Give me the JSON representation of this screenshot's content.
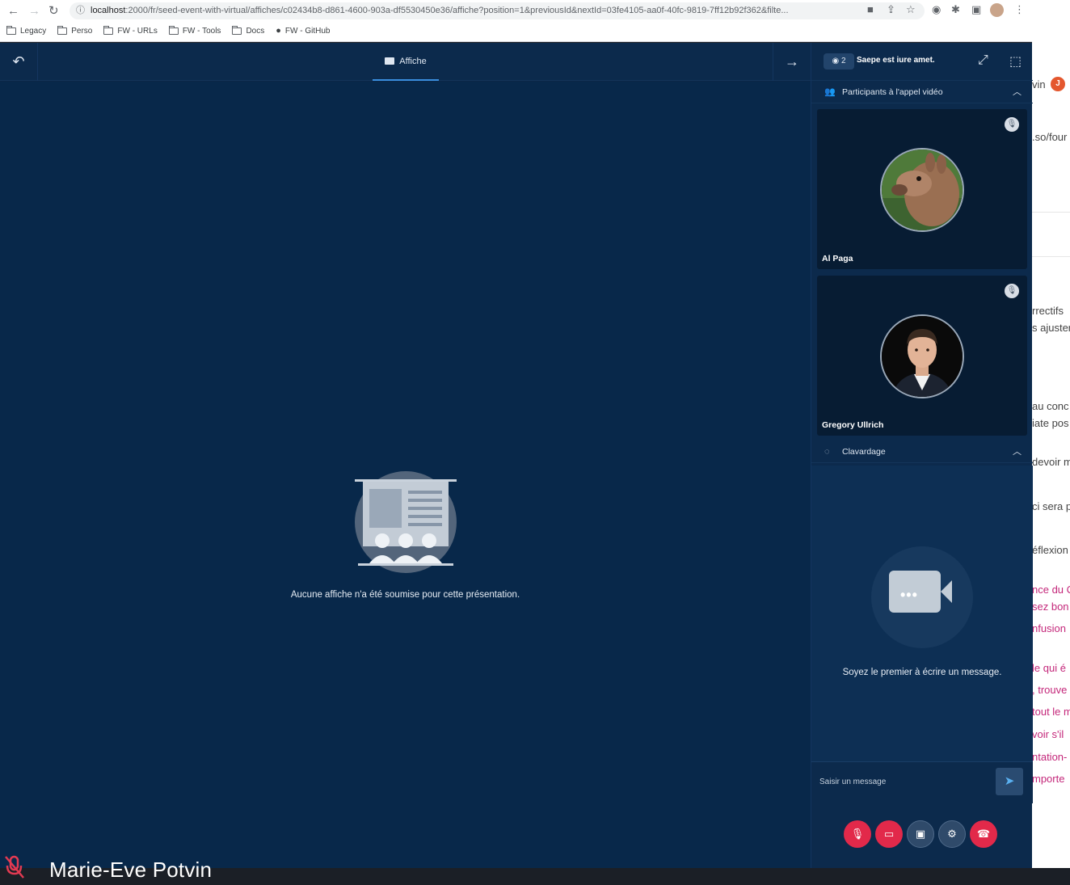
{
  "browser": {
    "url_host": "localhost",
    "url_rest": ":2000/fr/seed-event-with-virtual/affiches/c02434b8-d861-4600-903a-df5530450e36/affiche?position=1&previousId&nextId=03fe4105-aa0f-40fc-9819-7ff12b92f362&filte...",
    "bookmarks": [
      "Legacy",
      "Perso",
      "FW - URLs",
      "FW - Tools",
      "Docs",
      "FW - GitHub"
    ]
  },
  "topbar": {
    "tab_label": "Affiche"
  },
  "stage": {
    "empty_message": "Aucune affiche n'a été soumise pour cette présentation."
  },
  "self": {
    "name": "Marie-Eve Potvin"
  },
  "panel": {
    "viewer_count": "2",
    "room_title": "Saepe est iure amet.",
    "participants_title": "Participants à l'appel vidéo",
    "participants": [
      {
        "name": "Al Paga"
      },
      {
        "name": "Gregory Ullrich"
      }
    ],
    "chat_title": "Clavardage",
    "chat_empty": "Soyez le premier à écrire un message.",
    "chat_placeholder": "Saisir un message"
  },
  "background_doc": {
    "lines": [
      "vin",
      ".so/four",
      "rrectifs",
      "s ajuster",
      "au conc",
      "iate pos",
      "devoir m",
      "ci sera p",
      "éflexion",
      "nce du C",
      "sez bon",
      "nfusion",
      "le qui é",
      ", trouve",
      "tout le m",
      "voir s'il",
      "ntation-",
      "mporte"
    ],
    "badge": "J"
  },
  "colors": {
    "app_bg": "#0b2747",
    "accent": "#3a8dde",
    "danger": "#e2294a"
  }
}
